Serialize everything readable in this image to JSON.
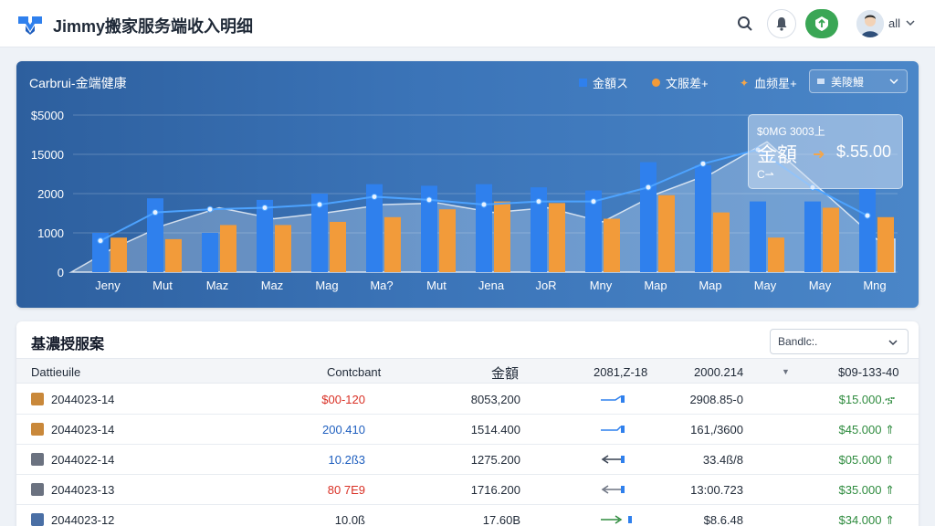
{
  "app": {
    "title": "Jimmy搬家服务端收入明细",
    "user_name": "all"
  },
  "colors": {
    "accent": "#2f80ed",
    "orange": "#f29b3a",
    "green": "#3aa655",
    "header_bg": "#ffffff"
  },
  "icons": {
    "logo": "box-logo-icon",
    "search": "search-icon",
    "bell": "bell-icon",
    "shield": "shield-icon"
  },
  "chart": {
    "title": "Carbrui-金端健康",
    "legend": [
      {
        "label": "金額ス",
        "color": "#2f80ed",
        "marker": "square"
      },
      {
        "label": "文服差+",
        "color": "#f29b3a",
        "marker": "circle"
      },
      {
        "label": "血频星+",
        "color": "#f29b3a",
        "marker": "star"
      }
    ],
    "range_select": "美陵鰻",
    "tooltip": {
      "header": "$0MG 3003上",
      "label": "金額",
      "value": "$.55.00",
      "footer": "C⇀"
    }
  },
  "chart_data": {
    "type": "bar",
    "categories": [
      "Jeny",
      "Mut",
      "Maz",
      "Maz",
      "Mag",
      "Ma?",
      "Mut",
      "Jena",
      "JoR",
      "Mny",
      "Map",
      "Map",
      "May",
      "May",
      "Mng"
    ],
    "yticks": [
      "0",
      "1000",
      "2000",
      "15000",
      "$5000"
    ],
    "ylim": [
      0,
      5000
    ],
    "series": [
      {
        "values": [
          1250,
          2350,
          1250,
          2300,
          2500,
          2800,
          2750,
          2800,
          2700,
          2600,
          3500,
          3400,
          2250,
          2250,
          2650
        ]
      },
      {
        "values": [
          1100,
          1050,
          1500,
          1500,
          1600,
          1750,
          2000,
          2250,
          2200,
          1700,
          2450,
          1900,
          1100,
          2050,
          1750
        ]
      },
      {
        "values": [
          1000,
          1900,
          2000,
          2050,
          2150,
          2400,
          2300,
          2150,
          2250,
          2250,
          2700,
          3450,
          3900,
          2700,
          1800
        ]
      },
      {
        "values": [
          700,
          1500,
          2050,
          1700,
          1900,
          2150,
          2200,
          1900,
          2050,
          1600,
          2500,
          3150,
          4150,
          2600,
          1050
        ]
      }
    ],
    "grid": true
  },
  "table": {
    "title": "基濃授服案",
    "filter": "Bandlc:.",
    "headers": [
      "Dattieuile",
      "Contcbant",
      "金額",
      "2081,Z-18",
      "2000.214",
      "$09-133-40"
    ],
    "rows": [
      {
        "icon_color": "#c9883a",
        "date": "2044023-14",
        "c2": "$00-120",
        "c2_color": "red",
        "c3": "8053,200",
        "c5": "2908.85-0",
        "c6": "$15.000.ኇ"
      },
      {
        "icon_color": "#c9883a",
        "date": "2044023-14",
        "c2": "200.410",
        "c2_color": "blue",
        "c3": "1514.400",
        "c5": "161,/3600",
        "c6": "$45.000 ⇑"
      },
      {
        "icon_color": "#6b7280",
        "date": "2044022-14",
        "c2": "10.2ß3",
        "c2_color": "blue",
        "c3": "1275.200",
        "c5": "33.4ß/8",
        "c6": "$05.000 ⇑"
      },
      {
        "icon_color": "#6b7280",
        "date": "2044023-13",
        "c2": "80 7E9",
        "c2_color": "red",
        "c3": "1716.200",
        "c5": "13:00.723",
        "c6": "$35.000 ⇑"
      },
      {
        "icon_color": "#4a6fa5",
        "date": "2044023-12",
        "c2": "10.0ß",
        "c2_color": "dark",
        "c3": "17.60B",
        "c5": "$8.6.48",
        "c6": "$34.000 ⇑"
      }
    ]
  }
}
